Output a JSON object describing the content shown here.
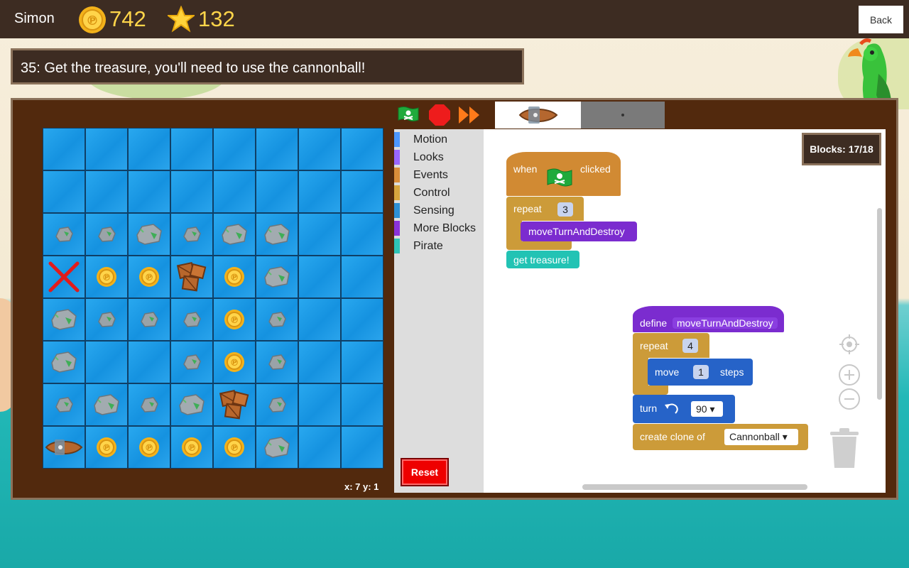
{
  "header": {
    "user_name": "Simon",
    "coins": "742",
    "stars": "132",
    "back_label": "Back"
  },
  "level": {
    "title": "35: Get the treasure, you'll need to use the cannonball!"
  },
  "grid": {
    "rows": [
      [
        "",
        "",
        "",
        "",
        "",
        "",
        "",
        ""
      ],
      [
        "",
        "",
        "",
        "",
        "",
        "",
        "",
        ""
      ],
      [
        "rock-s",
        "rock-s",
        "rock-l",
        "rock-s",
        "rock-l",
        "rock-l",
        "",
        ""
      ],
      [
        "x",
        "coin",
        "coin",
        "crate",
        "coin",
        "rock-l",
        "",
        ""
      ],
      [
        "rock-l",
        "rock-s",
        "rock-s",
        "rock-s",
        "coin",
        "rock-s",
        "",
        ""
      ],
      [
        "rock-l",
        "",
        "",
        "rock-s",
        "coin",
        "rock-s",
        "",
        ""
      ],
      [
        "rock-s",
        "rock-l",
        "rock-s",
        "rock-l",
        "crate",
        "rock-s",
        "",
        ""
      ],
      [
        "ship",
        "coin",
        "coin",
        "coin",
        "coin",
        "rock-l",
        "",
        ""
      ]
    ],
    "coordinates": "x: 7 y: 1"
  },
  "controls": {
    "run_icon": "pirate-flag-icon",
    "stop_icon": "stop-icon",
    "fast_icon": "fast-forward-icon"
  },
  "palette": {
    "categories": [
      {
        "label": "Motion",
        "color": "#4c97ff"
      },
      {
        "label": "Looks",
        "color": "#9966ff"
      },
      {
        "label": "Events",
        "color": "#d98d3a"
      },
      {
        "label": "Control",
        "color": "#d7a53e"
      },
      {
        "label": "Sensing",
        "color": "#2d8fd5"
      },
      {
        "label": "More Blocks",
        "color": "#8a32d9"
      },
      {
        "label": "Pirate",
        "color": "#2ec4b6"
      }
    ]
  },
  "reset_label": "Reset",
  "blocks_counter": "Blocks: 17/18",
  "script1": {
    "when": "when",
    "clicked": "clicked",
    "repeat": "repeat",
    "repeat_count": "3",
    "call": "moveTurnAndDestroy",
    "treasure": "get treasure!"
  },
  "script2": {
    "define": "define",
    "name": "moveTurnAndDestroy",
    "repeat": "repeat",
    "repeat_count": "4",
    "move": "move",
    "move_steps": "1",
    "steps": "steps",
    "turn": "turn",
    "turn_degrees": "90 ▾",
    "clone": "create clone of",
    "clone_target": "Cannonball ▾"
  },
  "colors": {
    "events": "#d18a33",
    "control": "#cc9b39",
    "more_blocks": "#7b2ccf",
    "motion": "#2663c8",
    "pirate": "#22c3b4"
  }
}
